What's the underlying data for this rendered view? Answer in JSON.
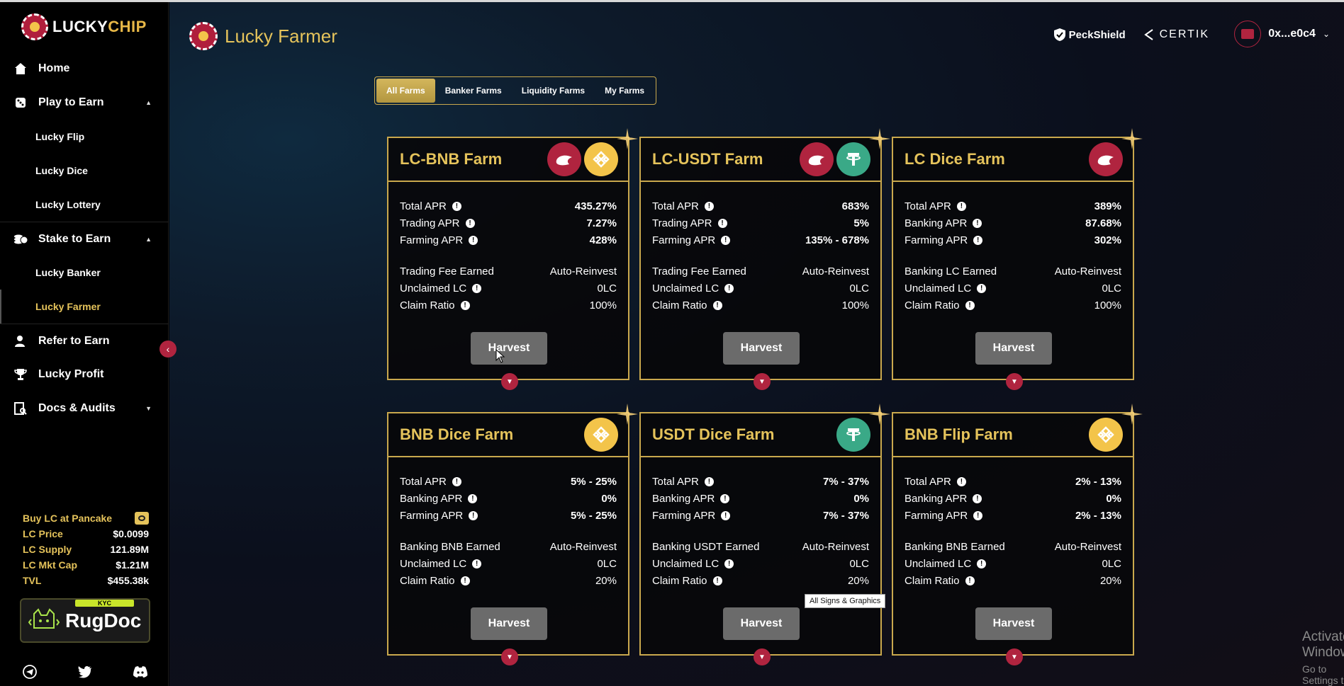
{
  "brand": {
    "name_part1": "LUCKY",
    "name_part2": "CHIP"
  },
  "sidebar": {
    "items": [
      {
        "label": "Home"
      },
      {
        "label": "Play to Earn"
      },
      {
        "label": "Lucky Flip"
      },
      {
        "label": "Lucky Dice"
      },
      {
        "label": "Lucky Lottery"
      },
      {
        "label": "Stake to Earn"
      },
      {
        "label": "Lucky Banker"
      },
      {
        "label": "Lucky Farmer"
      },
      {
        "label": "Refer to Earn"
      },
      {
        "label": "Lucky Profit"
      },
      {
        "label": "Docs & Audits"
      }
    ],
    "buy_label": "Buy LC at Pancake",
    "stats": [
      {
        "key": "LC Price",
        "value": "$0.0099"
      },
      {
        "key": "LC Supply",
        "value": "121.89M"
      },
      {
        "key": "LC Mkt Cap",
        "value": "$1.21M"
      },
      {
        "key": "TVL",
        "value": "$455.38k"
      }
    ],
    "rugdoc": {
      "badge": "KYC",
      "name": "RugDoc"
    }
  },
  "header": {
    "title": "Lucky Farmer",
    "audit1": "PeckShield",
    "audit2": "CERTIK",
    "wallet": "0x...e0c4"
  },
  "tabs": [
    "All Farms",
    "Banker Farms",
    "Liquidity Farms",
    "My Farms"
  ],
  "cards": [
    {
      "title": "LC-BNB Farm",
      "rows": [
        [
          "Total APR",
          "435.27%"
        ],
        [
          "Trading APR",
          "7.27%"
        ],
        [
          "Farming APR",
          "428%"
        ]
      ],
      "earned_label": "Trading Fee Earned",
      "earned_value": "Auto-Reinvest",
      "unclaimed": "0LC",
      "claim_ratio": "100%",
      "harvest": "Harvest"
    },
    {
      "title": "LC-USDT Farm",
      "rows": [
        [
          "Total APR",
          "683%"
        ],
        [
          "Trading APR",
          "5%"
        ],
        [
          "Farming APR",
          "135% - 678%"
        ]
      ],
      "earned_label": "Trading Fee Earned",
      "earned_value": "Auto-Reinvest",
      "unclaimed": "0LC",
      "claim_ratio": "100%",
      "harvest": "Harvest"
    },
    {
      "title": "LC Dice Farm",
      "rows": [
        [
          "Total APR",
          "389%"
        ],
        [
          "Banking APR",
          "87.68%"
        ],
        [
          "Farming APR",
          "302%"
        ]
      ],
      "earned_label": "Banking LC Earned",
      "earned_value": "Auto-Reinvest",
      "unclaimed": "0LC",
      "claim_ratio": "100%",
      "harvest": "Harvest"
    },
    {
      "title": "BNB Dice Farm",
      "rows": [
        [
          "Total APR",
          "5% - 25%"
        ],
        [
          "Banking APR",
          "0%"
        ],
        [
          "Farming APR",
          "5% - 25%"
        ]
      ],
      "earned_label": "Banking BNB Earned",
      "earned_value": "Auto-Reinvest",
      "unclaimed": "0LC",
      "claim_ratio": "20%",
      "harvest": "Harvest"
    },
    {
      "title": "USDT Dice Farm",
      "rows": [
        [
          "Total APR",
          "7% - 37%"
        ],
        [
          "Banking APR",
          "0%"
        ],
        [
          "Farming APR",
          "7% - 37%"
        ]
      ],
      "earned_label": "Banking USDT Earned",
      "earned_value": "Auto-Reinvest",
      "unclaimed": "0LC",
      "claim_ratio": "20%",
      "harvest": "Harvest"
    },
    {
      "title": "BNB Flip Farm",
      "rows": [
        [
          "Total APR",
          "2% - 13%"
        ],
        [
          "Banking APR",
          "0%"
        ],
        [
          "Farming APR",
          "2% - 13%"
        ]
      ],
      "earned_label": "Banking BNB Earned",
      "earned_value": "Auto-Reinvest",
      "unclaimed": "0LC",
      "claim_ratio": "20%",
      "harvest": "Harvest"
    }
  ],
  "labels": {
    "unclaimed": "Unclaimed LC",
    "claim_ratio": "Claim Ratio"
  },
  "tooltip": "All Signs & Graphics",
  "watermark": {
    "line1": "Activate Windows",
    "line2": "Go to Settings to activate Windows."
  },
  "colors": {
    "gold": "#e5c35b",
    "accent_red": "#b0243f",
    "bnb": "#f3c44a",
    "usdt": "#3aa987"
  }
}
